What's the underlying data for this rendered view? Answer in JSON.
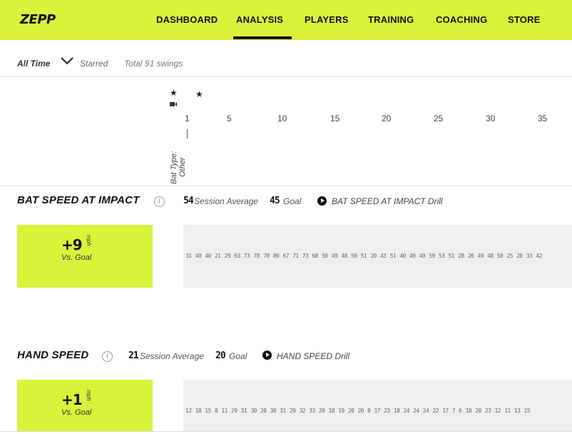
{
  "nav": {
    "logo": "ZEPP",
    "items": [
      {
        "label": "DASHBOARD"
      },
      {
        "label": "ANALYSIS",
        "active": true
      },
      {
        "label": "PLAYERS"
      },
      {
        "label": "TRAINING"
      },
      {
        "label": "COACHING"
      },
      {
        "label": "STORE"
      }
    ],
    "accent_color": "#d9f33a"
  },
  "filter": {
    "range": "All Time",
    "starred": "Starred",
    "total": "Total 91 swings"
  },
  "axis": {
    "ticks": [
      "1",
      "5",
      "10",
      "15",
      "20",
      "25",
      "30",
      "35"
    ],
    "bat_type": "Bat Type:",
    "bat_type_value": "Other"
  },
  "metrics": [
    {
      "title": "BAT SPEED AT IMPACT",
      "session_average": "54",
      "session_average_label": "Session Average",
      "goal": "45",
      "goal_label": "Goal",
      "drill": "BAT SPEED AT IMPACT Drill",
      "vs_goal": "+9",
      "unit": "mph",
      "vs_goal_label": "Vs. Goal",
      "values": "31 40 40 21 29 63 73 78 78 89 67 71 73 68 50 49 48 50 51 20 43 51 40 49 49 59 53 51 28 26 49 48 50 25 28 33 42"
    },
    {
      "title": "HAND SPEED",
      "session_average": "21",
      "session_average_label": "Session Average",
      "goal": "20",
      "goal_label": "Goal",
      "drill": "HAND SPEED Drill",
      "vs_goal": "+1",
      "unit": "mph",
      "vs_goal_label": "Vs. Goal",
      "values": "12 18 15 8 11 29 31 30 28 38 31 29 32 33 20 18 19 20 20 8 17 23 18 24 24 24 22 17 7 6 18 20 23 12 11 13 15"
    }
  ]
}
